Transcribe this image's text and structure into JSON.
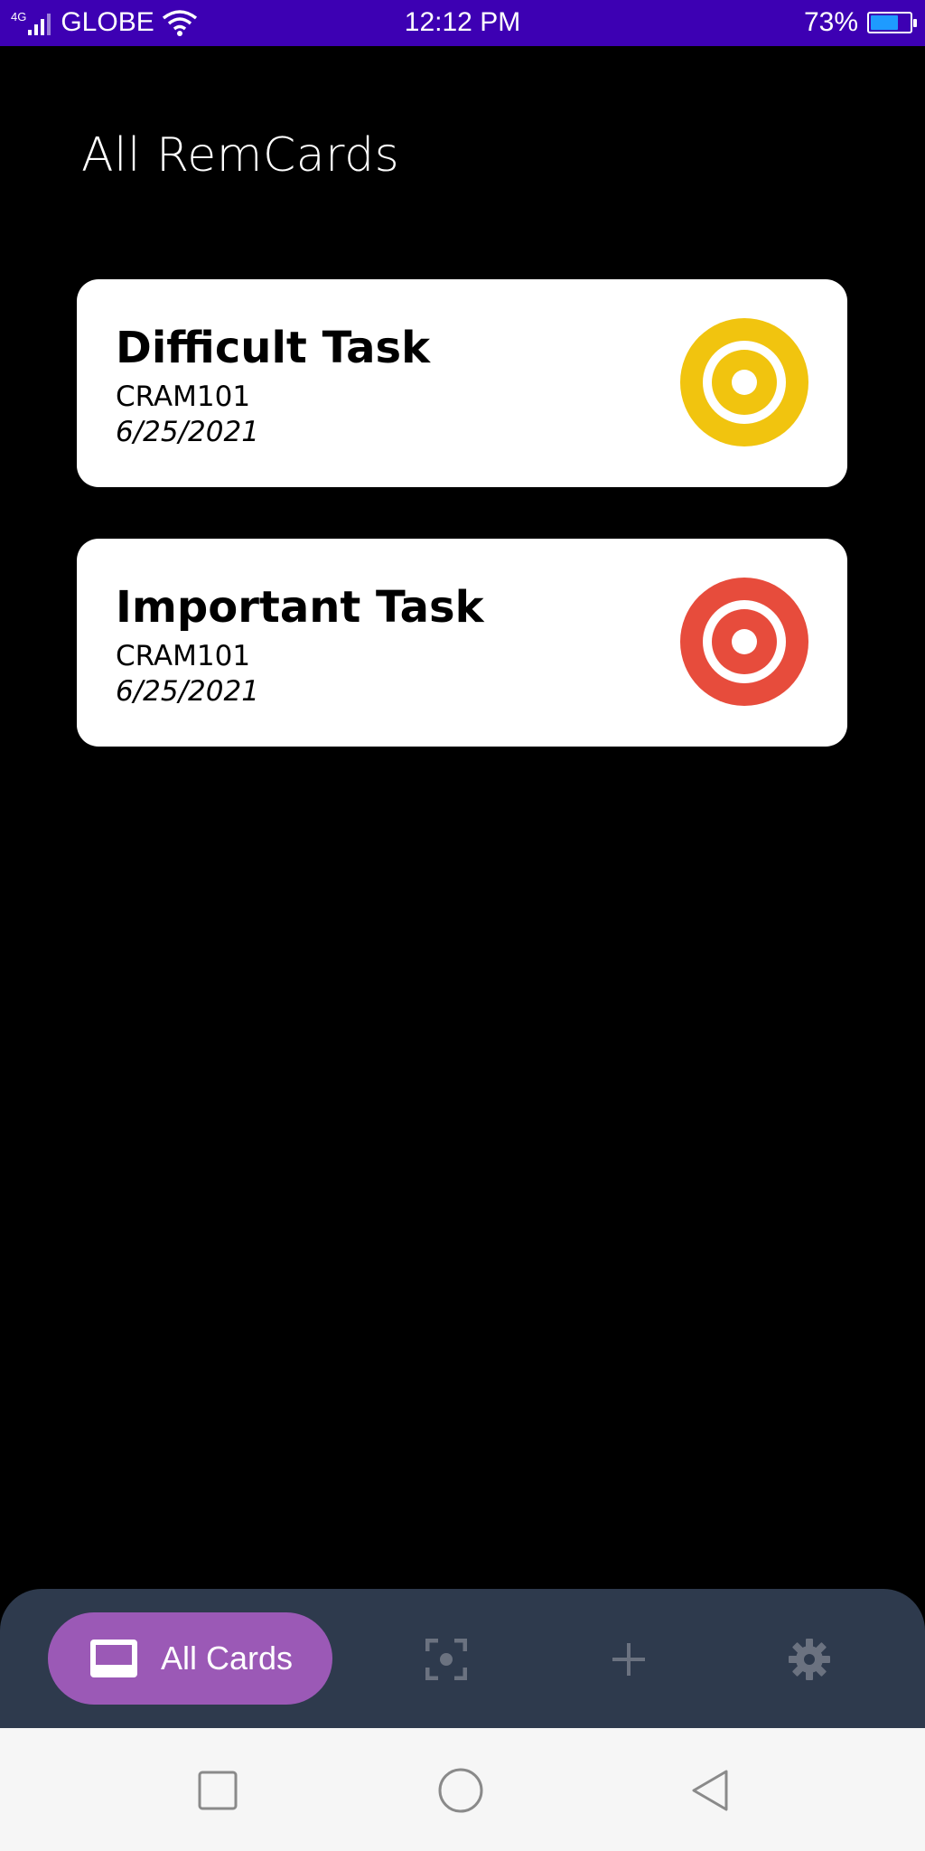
{
  "status_bar": {
    "network": "4G",
    "carrier": "GLOBE",
    "time": "12:12 PM",
    "battery": "73%",
    "battery_level": 0.73
  },
  "header": {
    "title": "All RemCards"
  },
  "cards": [
    {
      "title": "Difficult Task",
      "course": "CRAM101",
      "date": "6/25/2021",
      "icon": "target-icon",
      "color": "#f1c40f"
    },
    {
      "title": "Important Task",
      "course": "CRAM101",
      "date": "6/25/2021",
      "icon": "target-icon",
      "color": "#e74c3c"
    }
  ],
  "bottom_nav": {
    "active_label": "All Cards",
    "items": [
      {
        "icon": "cards-icon",
        "label": "All Cards"
      },
      {
        "icon": "scan-icon"
      },
      {
        "icon": "plus-icon"
      },
      {
        "icon": "gear-icon"
      }
    ],
    "active_color": "#9b59b6",
    "background": "#2e3a4d"
  },
  "system_nav": {
    "icons": [
      "square-icon",
      "circle-icon",
      "back-triangle-icon"
    ]
  }
}
